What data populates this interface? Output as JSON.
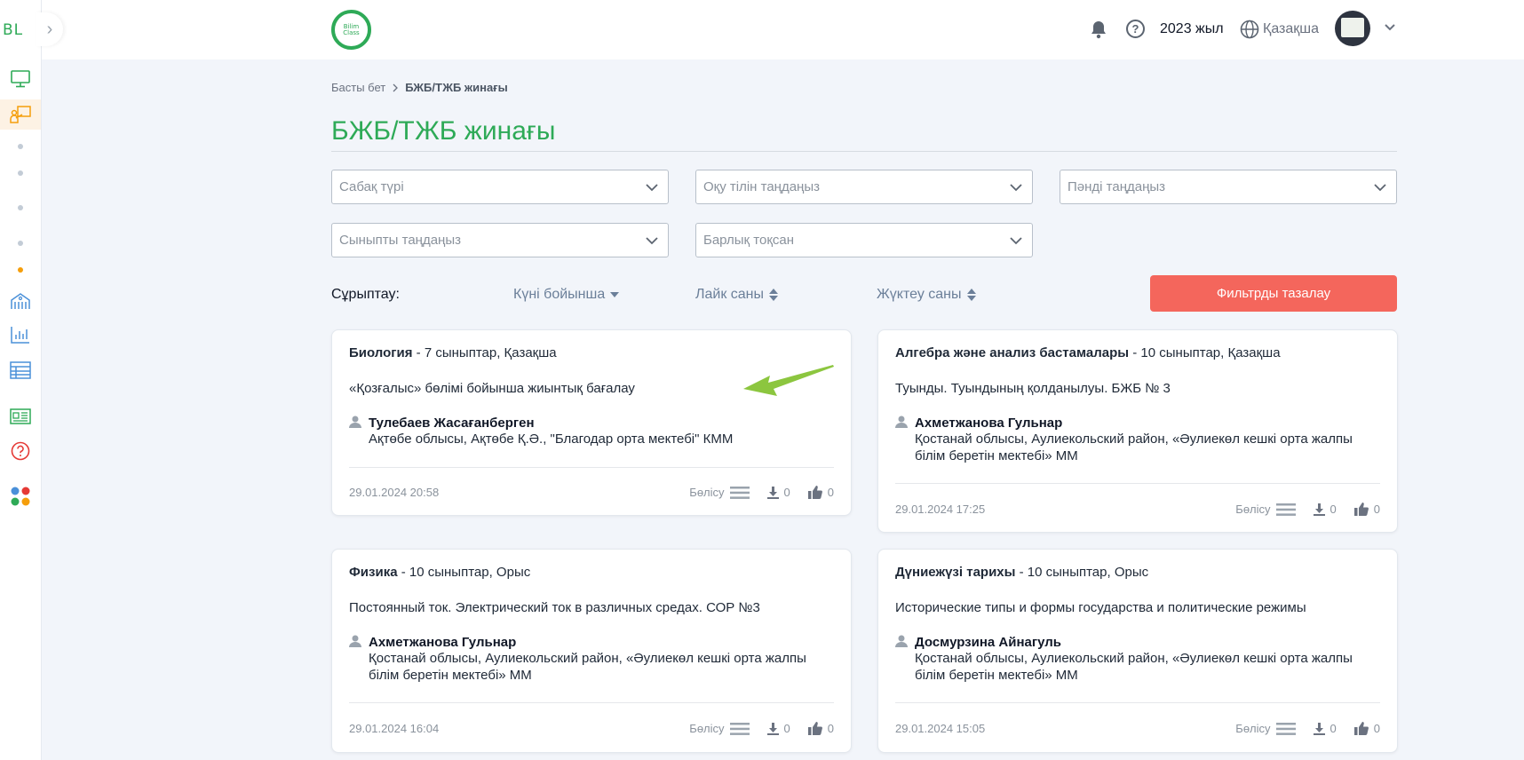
{
  "sidebar": {
    "logo_text": "BL",
    "toggle_glyph": "›",
    "items": [
      {
        "icon": "monitor-icon"
      },
      {
        "icon": "teacher-board-icon",
        "active": true
      },
      {
        "icon": "dot"
      },
      {
        "icon": "dot"
      },
      {
        "icon": "dot"
      },
      {
        "icon": "dot"
      },
      {
        "icon": "dot",
        "active_dot": true
      },
      {
        "icon": "school-icon"
      },
      {
        "icon": "bar-chart-icon"
      },
      {
        "icon": "table-icon"
      },
      {
        "icon": "news-icon"
      },
      {
        "icon": "help-circle-icon"
      },
      {
        "icon": "apps-icon"
      }
    ]
  },
  "topbar": {
    "brand_line1": "Bilim",
    "brand_line2": "Class",
    "year": "2023 жыл",
    "language": "Қазақша",
    "help_glyph": "?"
  },
  "breadcrumb": {
    "home": "Басты бет",
    "current": "БЖБ/ТЖБ жинағы"
  },
  "page_title": "БЖБ/ТЖБ жинағы",
  "filters": {
    "lesson_type": "Сабақ түрі",
    "language": "Оқу тілін таңдаңыз",
    "subject": "Пәнді таңдаңыз",
    "grade": "Сыныпты таңдаңыз",
    "quarter": "Барлық тоқсан"
  },
  "sort": {
    "label": "Сұрыптау:",
    "by_date": "Күні бойынша",
    "by_likes": "Лайк саны",
    "by_downloads": "Жүктеу саны"
  },
  "clear_filters": "Фильтрды тазалау",
  "colors": {
    "brand_green": "#2eaa57",
    "danger": "#f4665c",
    "arrow": "#8cc63f"
  },
  "cards": [
    {
      "subject": "Биология",
      "meta": " - 7 сыныптар, Қазақша",
      "description": "«Қозғалыс» бөлімі бойынша жиынтық бағалау",
      "author": "Тулебаев Жасағанберген",
      "org": "Ақтөбе облысы, Ақтөбе Қ.Ә., \"Благодар орта мектебі\" КММ",
      "date": "29.01.2024 20:58",
      "share": "Бөлісу",
      "downloads": "0",
      "likes": "0"
    },
    {
      "subject": "Алгебра және анализ бастамалары",
      "meta": " - 10 сыныптар, Қазақша",
      "description": "Туынды. Туындының қолданылуы. БЖБ № 3",
      "author": "Ахметжанова Гульнар",
      "org": "Қостанай облысы, Аулиекольский район, «Әулиекөл кешкі орта жалпы білім беретін мектебі» ММ",
      "date": "29.01.2024 17:25",
      "share": "Бөлісу",
      "downloads": "0",
      "likes": "0"
    },
    {
      "subject": "Физика",
      "meta": " - 10 сыныптар, Орыс",
      "description": "Постоянный ток. Электрический ток в различных средах. СОР №3",
      "author": "Ахметжанова Гульнар",
      "org": "Қостанай облысы, Аулиекольский район, «Әулиекөл кешкі орта жалпы білім беретін мектебі» ММ",
      "date": "29.01.2024 16:04",
      "share": "Бөлісу",
      "downloads": "0",
      "likes": "0"
    },
    {
      "subject": "Дүниежүзі тарихы",
      "meta": " - 10 сыныптар, Орыс",
      "description": "Исторические типы и формы государства и политические режимы",
      "author": "Досмурзина Айнагуль",
      "org": "Қостанай облысы, Аулиекольский район, «Әулиекөл кешкі орта жалпы білім беретін мектебі» ММ",
      "date": "29.01.2024 15:05",
      "share": "Бөлісу",
      "downloads": "0",
      "likes": "0"
    }
  ]
}
